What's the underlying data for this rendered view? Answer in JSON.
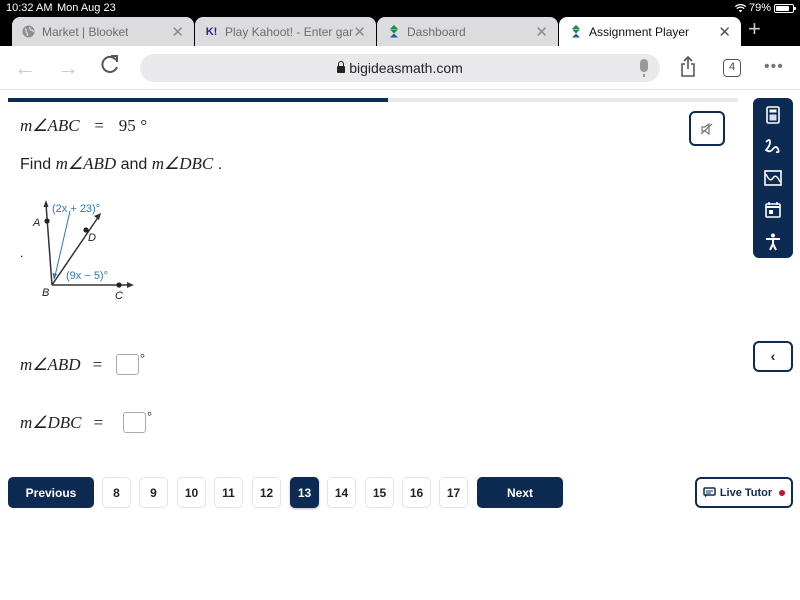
{
  "status_bar": {
    "time": "10:32 AM",
    "date": "Mon Aug 23",
    "battery": "79%"
  },
  "tabs": [
    {
      "label": "Market | Blooket",
      "icon": "globe-icon",
      "active": false
    },
    {
      "label": "Play Kahoot! - Enter gam",
      "icon_text": "K!",
      "icon": "kahoot-icon",
      "active": false
    },
    {
      "label": "Dashboard",
      "icon": "bigideas-icon",
      "active": false
    },
    {
      "label": "Assignment Player",
      "icon": "bigideas-icon",
      "active": true
    }
  ],
  "toolbar": {
    "url": "bigideasmath.com",
    "tab_count": "4",
    "more": "•••"
  },
  "progress": {
    "fraction": 0.52
  },
  "question": {
    "given_lhs": "m∠ABC",
    "given_eq": "=",
    "given_value": "95",
    "given_unit": "°",
    "prompt_find": "Find",
    "prompt_angle1": "m∠ABD",
    "prompt_and": "and",
    "prompt_angle2": "m∠DBC",
    "prompt_end": ".",
    "stray_dot": "."
  },
  "figure": {
    "label_a": "A",
    "label_b": "B",
    "label_c": "C",
    "label_d": "D",
    "expr_abd": "(2x + 23)°",
    "expr_dbc": "(9x − 5)°"
  },
  "answers": [
    {
      "label": "m∠ABD",
      "eq": "=",
      "value": "",
      "unit": "°"
    },
    {
      "label": "m∠DBC",
      "eq": "=",
      "value": "",
      "unit": "°"
    }
  ],
  "side_tools": [
    "calculator-icon",
    "scribble-icon",
    "graph-icon",
    "calendar-icon",
    "accessibility-icon"
  ],
  "collapse_label": "‹",
  "pagination": {
    "previous_label": "Previous",
    "next_label": "Next",
    "pages": [
      "8",
      "9",
      "10",
      "11",
      "12",
      "13",
      "14",
      "15",
      "16",
      "17"
    ],
    "current": "13"
  },
  "live_tutor": {
    "label": "Live Tutor",
    "status_color": "#c8102e"
  },
  "colors": {
    "brand": "#0d2b52",
    "figure_blue": "#2a7ab8"
  }
}
